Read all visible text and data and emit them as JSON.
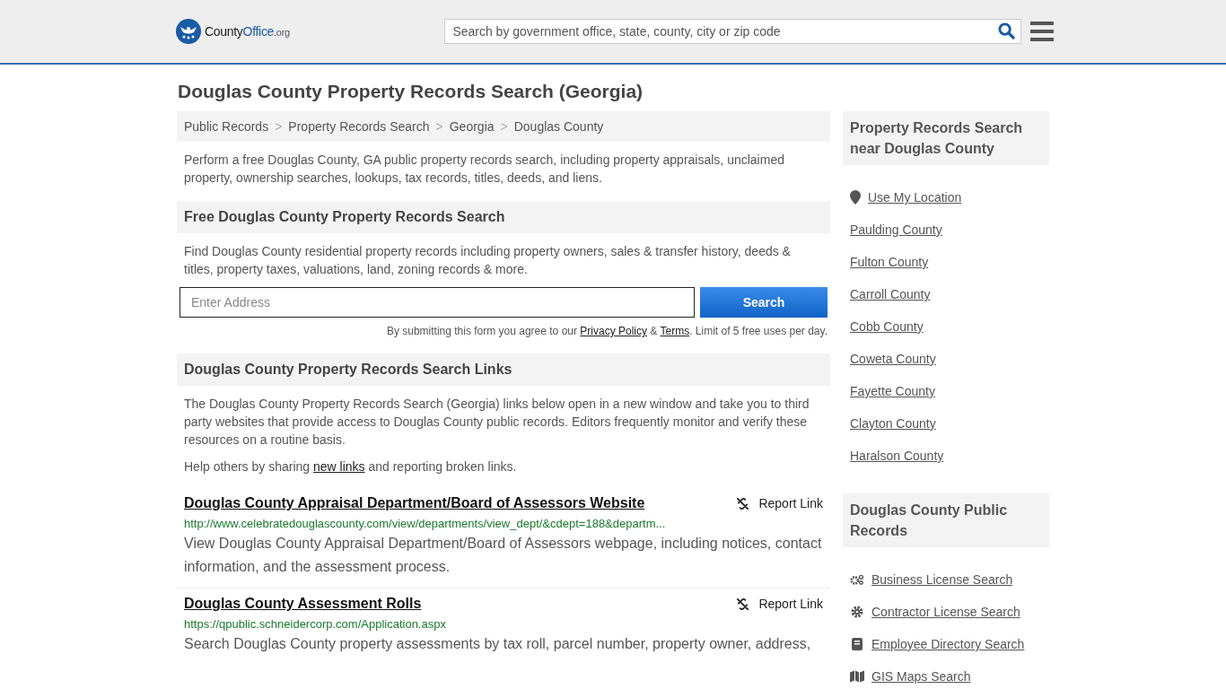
{
  "header": {
    "logo": {
      "part1": "County",
      "part2": "Office",
      "suffix": ".org"
    },
    "search": {
      "placeholder": "Search by government office, state, county, city or zip code"
    }
  },
  "title": "Douglas County Property Records Search (Georgia)",
  "breadcrumb_separator": ">",
  "breadcrumbs": [
    "Public Records",
    "Property Records Search",
    "Georgia",
    "Douglas County"
  ],
  "intro": "Perform a free Douglas County, GA public property records search, including property appraisals, unclaimed property, ownership searches, lookups, tax records, titles, deeds, and liens.",
  "free_search": {
    "heading": "Free Douglas County Property Records Search",
    "text": "Find Douglas County residential property records including property owners, sales & transfer history, deeds & titles, property taxes, valuations, land, zoning records & more.",
    "placeholder": "Enter Address",
    "button": "Search",
    "terms_before": "By submitting this form you agree to our",
    "privacy": "Privacy Policy",
    "amp": "&",
    "terms": "Terms",
    "terms_after": ". Limit of 5 free uses per day."
  },
  "links_section": {
    "heading": "Douglas County Property Records Search Links",
    "text": "The Douglas County Property Records Search (Georgia) links below open in a new window and take you to third party websites that provide access to Douglas County public records. Editors frequently monitor and verify these resources on a routine basis.",
    "help_before": "Help others by sharing",
    "help_link": "new links",
    "help_after": "and reporting broken links."
  },
  "links": [
    {
      "title": "Douglas County Appraisal Department/Board of Assessors Website",
      "report": "Report Link",
      "url": "http://www.celebratedouglascounty.com/view/departments/view_dept/&cdept=188&departm...",
      "description": "View Douglas County Appraisal Department/Board of Assessors webpage, including notices, contact information, and the assessment process."
    },
    {
      "title": "Douglas County Assessment Rolls",
      "report": "Report Link",
      "url": "https://qpublic.schneidercorp.com/Application.aspx",
      "description": "Search Douglas County property assessments by tax roll, parcel number, property owner, address,"
    }
  ],
  "sidebar": {
    "nearby": {
      "heading": "Property Records Search near Douglas County",
      "location": "Use My Location",
      "items": [
        "Paulding County",
        "Fulton County",
        "Carroll County",
        "Cobb County",
        "Coweta County",
        "Fayette County",
        "Clayton County",
        "Haralson County"
      ]
    },
    "public": {
      "heading": "Douglas County Public Records",
      "items": [
        {
          "kind": "gears",
          "label": "Business License Search"
        },
        {
          "kind": "gear",
          "label": "Contractor License Search"
        },
        {
          "kind": "book",
          "label": "Employee Directory Search"
        },
        {
          "kind": "map",
          "label": "GIS Maps Search"
        }
      ]
    }
  }
}
